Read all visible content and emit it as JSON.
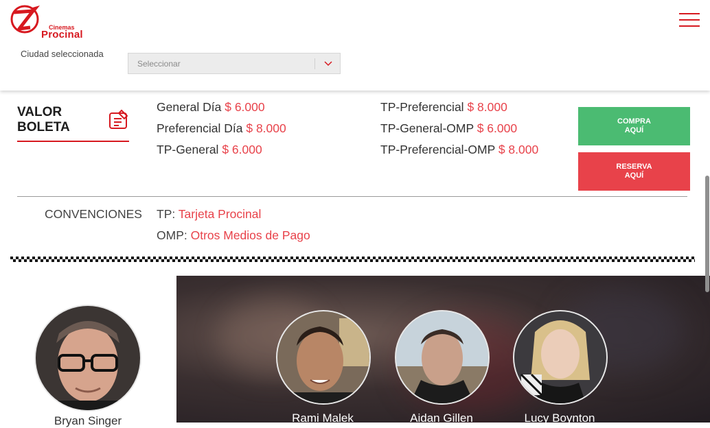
{
  "header": {
    "logo_small": "Cinemas",
    "logo_big": "Procinal",
    "city_label": "Ciudad seleccionada",
    "city_placeholder": "Seleccionar",
    "menu_icon": "hamburger-icon"
  },
  "prices": {
    "title_line1": "VALOR",
    "title_line2": "BOLETA",
    "left": [
      {
        "label": "General Día",
        "value": "$ 6.000"
      },
      {
        "label": "Preferencial Día",
        "value": "$ 8.000"
      },
      {
        "label": "TP-General",
        "value": "$ 6.000"
      }
    ],
    "right": [
      {
        "label": "TP-Preferencial",
        "value": "$ 8.000"
      },
      {
        "label": "TP-General-OMP",
        "value": "$ 6.000"
      },
      {
        "label": "TP-Preferencial-OMP",
        "value": "$ 8.000"
      }
    ],
    "buy_line1": "COMPRA",
    "buy_line2": "AQUÍ",
    "reserve_line1": "RESERVA",
    "reserve_line2": "AQUÍ"
  },
  "conventions": {
    "label": "CONVENCIONES",
    "items": [
      {
        "key": "TP: ",
        "value": "Tarjeta Procinal"
      },
      {
        "key": "OMP: ",
        "value": "Otros Medios de Pago"
      }
    ]
  },
  "director": {
    "name": "Bryan Singer"
  },
  "cast": [
    {
      "name": "Rami Malek"
    },
    {
      "name": "Aidan Gillen"
    },
    {
      "name": "Lucy Boynton"
    }
  ],
  "colors": {
    "brand_red": "#d71920",
    "price_red": "#e8424a",
    "buy_green": "#4bbb72"
  }
}
